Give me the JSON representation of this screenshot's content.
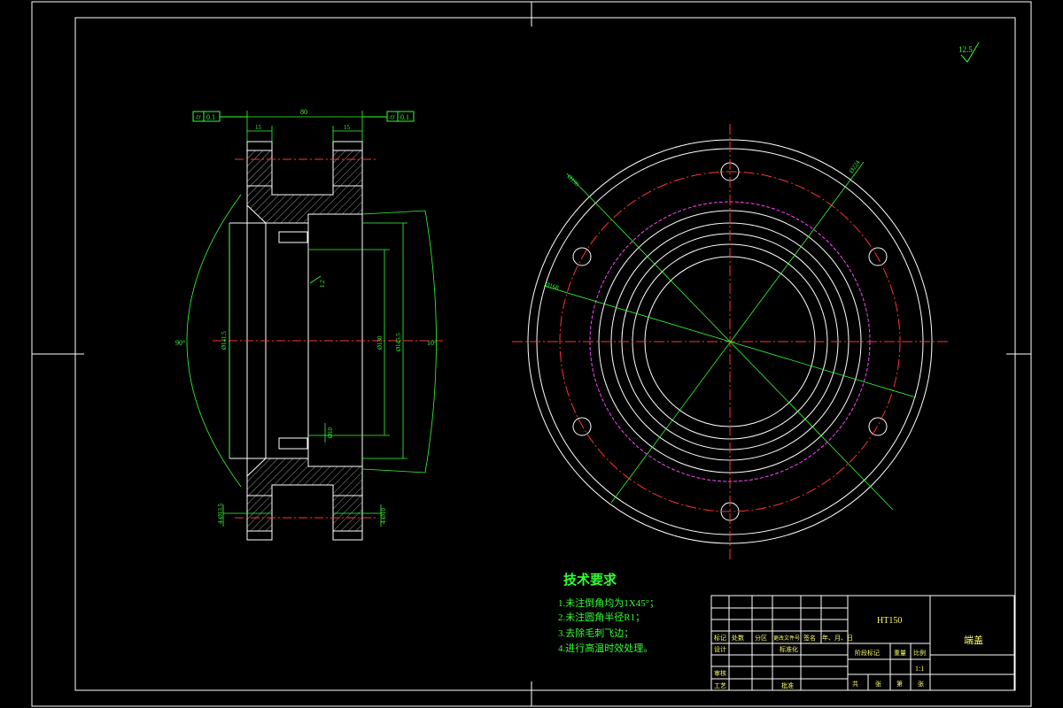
{
  "roughness_symbol": "12.5",
  "section_view": {
    "dimensions": {
      "overall_width": "80",
      "left_flange": "15",
      "right_flange": "15",
      "diameter_a": "Ø141.5",
      "diameter_b": "Ø130",
      "diameter_c": "Ø145.5",
      "chamfer": "1.2",
      "angle_left": "90°",
      "angle_right": "10°",
      "hole_depth": "Ø10",
      "hole_left": "4-Ø13.5",
      "hole_right": "4-Ø10"
    },
    "tolerance_left": [
      "⌭",
      "0.1"
    ],
    "tolerance_right": [
      "⌭",
      "0.1"
    ]
  },
  "end_view": {
    "dimensions": {
      "bolt_circle": "Ø190",
      "outer": "Ø224",
      "inner": "Ø168"
    }
  },
  "tech_requirements": {
    "title": "技术要求",
    "items": [
      "1.未注倒角均为1X45°；",
      "2.未注圆角半径R1；",
      "3.去除毛刺飞边；",
      "4.进行高温时效处理。"
    ]
  },
  "title_block": {
    "material": "HT150",
    "part_name": "端盖",
    "scale": "1:1",
    "header_labels": [
      "标记",
      "处数",
      "分区",
      "更改文件号",
      "签名",
      "年、月、日"
    ],
    "row_labels": [
      "设计",
      "审核",
      "工艺"
    ],
    "standardization": "标准化",
    "approve": "批准",
    "stage_mark": "阶段标记",
    "weight": "重量",
    "scale_label": "比例",
    "sheets": [
      "共",
      "张",
      "第",
      "张"
    ]
  }
}
